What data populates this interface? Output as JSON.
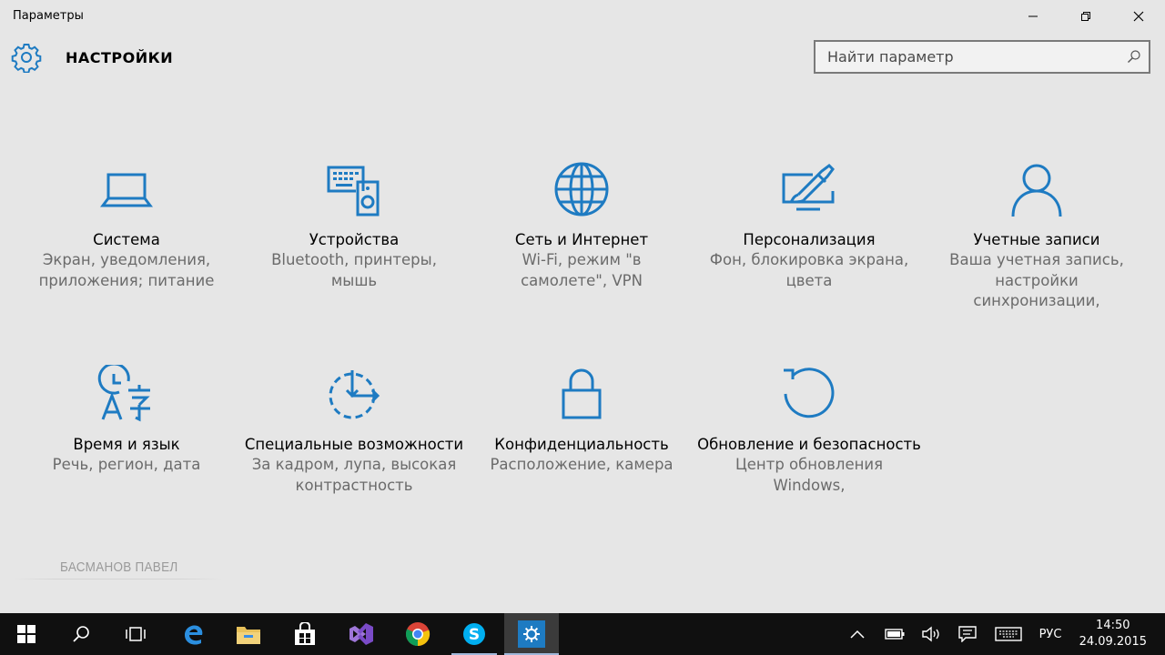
{
  "window": {
    "title": "Параметры"
  },
  "header": {
    "heading": "НАСТРОЙКИ"
  },
  "search": {
    "placeholder": "Найти параметр"
  },
  "tiles": [
    {
      "name": "Система",
      "desc": "Экран, уведомления, приложения; питание",
      "icon": "laptop-icon"
    },
    {
      "name": "Устройства",
      "desc": "Bluetooth, принтеры, мышь",
      "icon": "devices-icon"
    },
    {
      "name": "Сеть и Интернет",
      "desc": "Wi-Fi, режим \"в самолете\", VPN",
      "icon": "globe-icon"
    },
    {
      "name": "Персонализация",
      "desc": "Фон, блокировка экрана, цвета",
      "icon": "personalization-icon"
    },
    {
      "name": "Учетные записи",
      "desc": "Ваша учетная запись, настройки синхронизации,",
      "icon": "user-icon"
    },
    {
      "name": "Время и язык",
      "desc": "Речь, регион, дата",
      "icon": "time-language-icon"
    },
    {
      "name": "Специальные возможности",
      "desc": "За кадром, лупа, высокая контрастность",
      "icon": "ease-of-access-icon"
    },
    {
      "name": "Конфиденциальность",
      "desc": "Расположение, камера",
      "icon": "lock-icon"
    },
    {
      "name": "Обновление и безопасность",
      "desc": "Центр обновления Windows,",
      "icon": "update-icon"
    }
  ],
  "watermark": "БАСМАНОВ ПАВЕЛ",
  "taskbar": {
    "language": "РУС",
    "time": "14:50",
    "date": "24.09.2015"
  },
  "colors": {
    "accent": "#1e7bc2",
    "background": "#e6e6e6",
    "taskbar": "#101010"
  }
}
